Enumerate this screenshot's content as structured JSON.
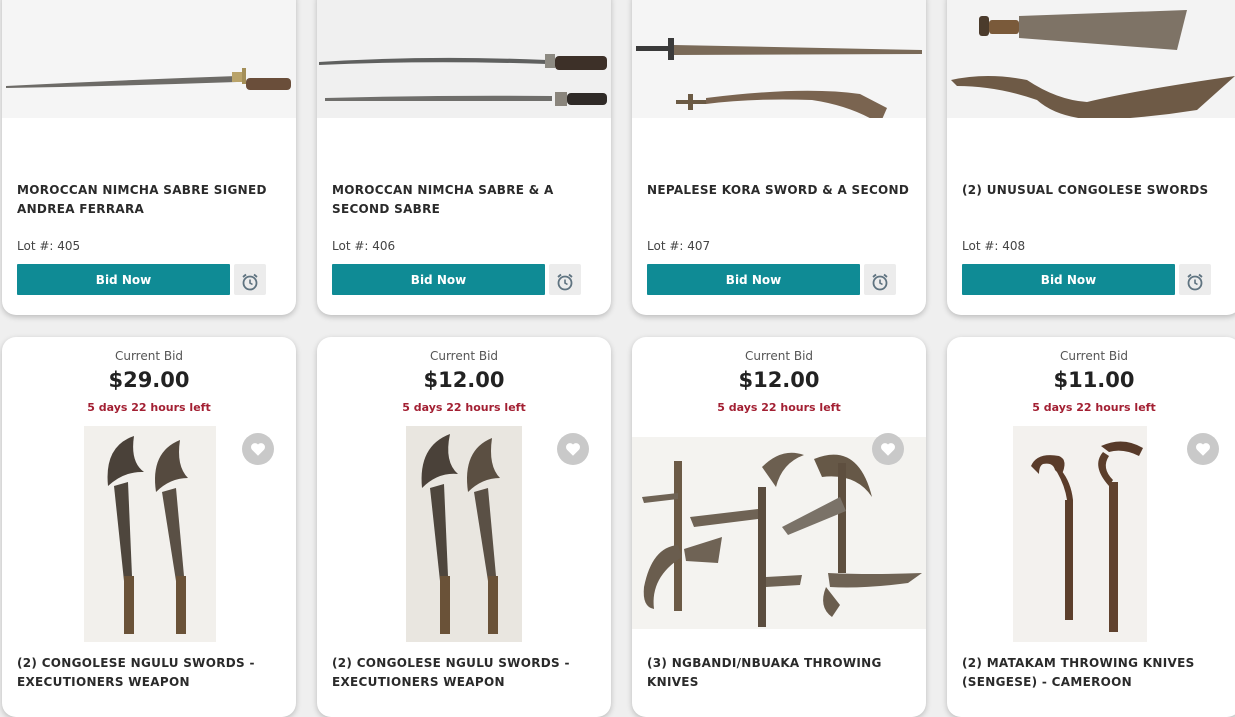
{
  "colors": {
    "accent": "#0f8b95",
    "time_left": "#a32033",
    "heart_bg": "#c9c9c9"
  },
  "icons": {
    "watch": "alarm-clock-icon",
    "favorite": "heart-icon"
  },
  "top_lots": [
    {
      "title": "MOROCCAN NIMCHA SABRE SIGNED ANDREA FERRARA",
      "lot": "Lot #: 405",
      "bid_label": "Bid Now"
    },
    {
      "title": "MOROCCAN NIMCHA SABRE & A SECOND SABRE",
      "lot": "Lot #: 406",
      "bid_label": "Bid Now"
    },
    {
      "title": "NEPALESE KORA SWORD & A SECOND",
      "lot": "Lot #: 407",
      "bid_label": "Bid Now"
    },
    {
      "title": "(2) UNUSUAL CONGOLESE SWORDS",
      "lot": "Lot #: 408",
      "bid_label": "Bid Now"
    }
  ],
  "bottom_lots": [
    {
      "current_bid_label": "Current Bid",
      "current_bid": "$29.00",
      "time_left": "5 days 22 hours left",
      "title": "(2) CONGOLESE NGULU SWORDS - EXECUTIONERS WEAPON"
    },
    {
      "current_bid_label": "Current Bid",
      "current_bid": "$12.00",
      "time_left": "5 days 22 hours left",
      "title": "(2) CONGOLESE NGULU SWORDS - EXECUTIONERS WEAPON"
    },
    {
      "current_bid_label": "Current Bid",
      "current_bid": "$12.00",
      "time_left": "5 days 22 hours left",
      "title": "(3) NGBANDI/NBUAKA THROWING KNIVES"
    },
    {
      "current_bid_label": "Current Bid",
      "current_bid": "$11.00",
      "time_left": "5 days 22 hours left",
      "title": "(2) MATAKAM THROWING KNIVES (SENGESE) - CAMEROON"
    }
  ]
}
